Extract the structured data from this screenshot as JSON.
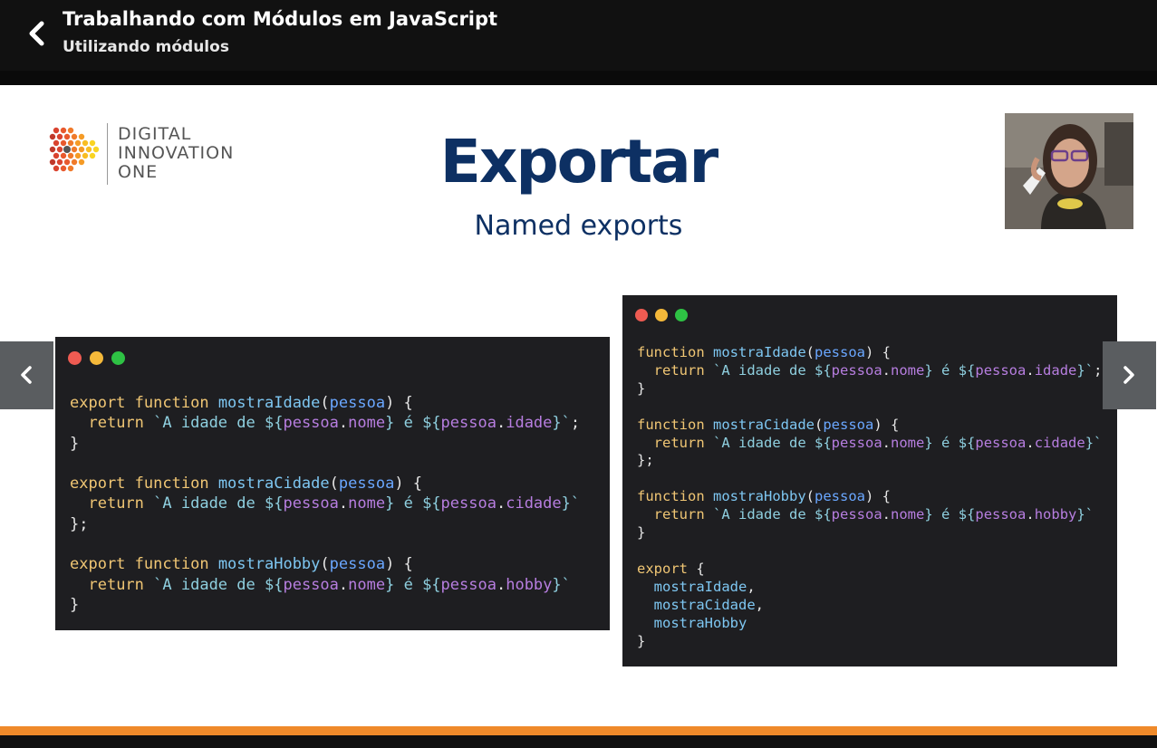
{
  "header": {
    "title": "Trabalhando com Módulos em JavaScript",
    "subtitle": "Utilizando módulos"
  },
  "slide": {
    "logo_lines": [
      "DIGITAL",
      "INNOVATION",
      "ONE"
    ],
    "title": "Exportar",
    "subtitle": "Named exports"
  },
  "colors": {
    "title_blue": "#0d3063",
    "progress_orange": "#ef8a2a",
    "code_bg": "#1e1e21"
  },
  "code_left": {
    "lines": [
      "export function mostraIdade(pessoa) {",
      "  return `A idade de ${pessoa.nome} é ${pessoa.idade}`;",
      "}",
      "",
      "export function mostraCidade(pessoa) {",
      "  return `A idade de ${pessoa.nome} é ${pessoa.cidade}`",
      "};",
      "",
      "export function mostraHobby(pessoa) {",
      "  return `A idade de ${pessoa.nome} é ${pessoa.hobby}`",
      "}"
    ]
  },
  "code_right": {
    "lines": [
      "function mostraIdade(pessoa) {",
      "  return `A idade de ${pessoa.nome} é ${pessoa.idade}`;",
      "}",
      "",
      "function mostraCidade(pessoa) {",
      "  return `A idade de ${pessoa.nome} é ${pessoa.cidade}`",
      "};",
      "",
      "function mostraHobby(pessoa) {",
      "  return `A idade de ${pessoa.nome} é ${pessoa.hobby}`",
      "}",
      "",
      "export {",
      "  mostraIdade,",
      "  mostraCidade,",
      "  mostraHobby",
      "}"
    ]
  },
  "icons": {
    "back": "chevron-left-icon",
    "prev": "chevron-left-icon",
    "next": "chevron-right-icon"
  }
}
